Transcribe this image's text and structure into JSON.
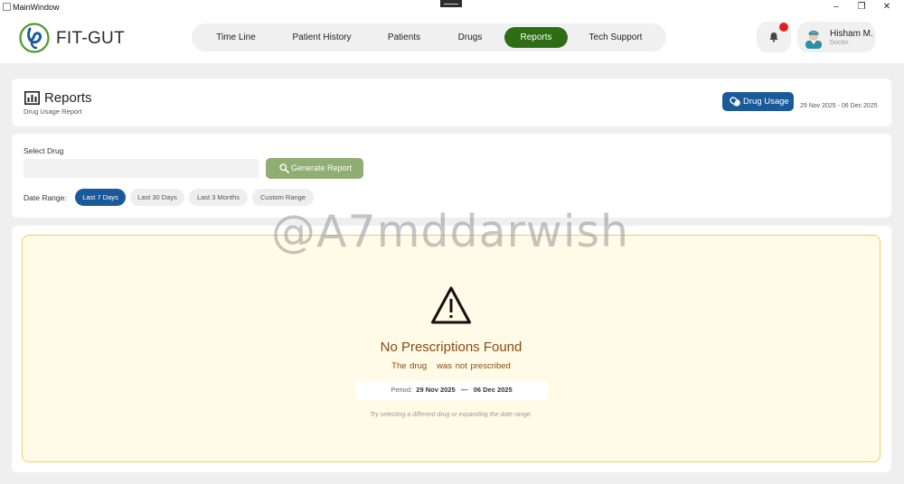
{
  "window": {
    "title": "MainWindow"
  },
  "header": {
    "brand": "FIT-GUT",
    "nav": [
      {
        "label": "Time Line",
        "active": false
      },
      {
        "label": "Patient History",
        "active": false
      },
      {
        "label": "Patients",
        "active": false
      },
      {
        "label": "Drugs",
        "active": false
      },
      {
        "label": "Reports",
        "active": true
      },
      {
        "label": "Tech Support",
        "active": false
      }
    ],
    "user": {
      "name": "Hisham M.",
      "role": "Doctor"
    }
  },
  "reports": {
    "title": "Reports",
    "subtitle": "Drug Usage Report",
    "drug_usage_button": "Drug Usage",
    "date_range_text": "29 Nov 2025 - 06 Dec 2025"
  },
  "filter": {
    "select_label": "Select Drug",
    "drug_value": "",
    "generate_button": "Generate Report",
    "date_range_label": "Date Range:",
    "ranges": [
      {
        "label": "Last 7 Days",
        "active": true
      },
      {
        "label": "Last 30 Days",
        "active": false
      },
      {
        "label": "Last 3 Months",
        "active": false
      },
      {
        "label": "Custom Range",
        "active": false
      }
    ]
  },
  "result": {
    "title": "No Prescriptions Found",
    "message": "The drug   was not prescribed",
    "period_label": "Period:",
    "period_start": "29 Nov 2025",
    "period_sep": "—",
    "period_end": "06 Dec 2025",
    "hint": "Try selecting a different drug or expanding the date range."
  },
  "watermark": "@A7mddarwish",
  "colors": {
    "nav_active": "#2e6d15",
    "primary_blue": "#1b5a99",
    "generate_green": "#8fae71",
    "warning_bg": "#fffbe6",
    "warning_border": "#f0d05a",
    "warning_text": "#8a4a14",
    "notification": "#e02020"
  }
}
